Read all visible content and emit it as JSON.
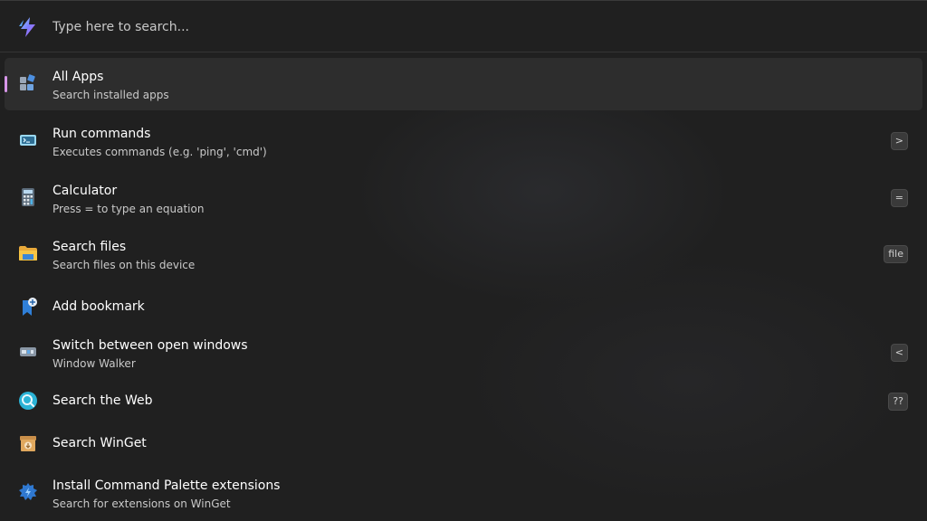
{
  "search": {
    "placeholder": "Type here to search...",
    "logo_icon": "lightning-bolt-icon"
  },
  "items": [
    {
      "title": "All Apps",
      "subtitle": "Search installed apps",
      "icon": "all-apps-icon",
      "shortcut": "",
      "selected": true
    },
    {
      "title": "Run commands",
      "subtitle": "Executes commands (e.g. 'ping', 'cmd')",
      "icon": "terminal-icon",
      "shortcut": ">"
    },
    {
      "title": "Calculator",
      "subtitle": "Press = to type an equation",
      "icon": "calculator-icon",
      "shortcut": "="
    },
    {
      "title": "Search files",
      "subtitle": "Search files on this device",
      "icon": "folder-icon",
      "shortcut": "file"
    },
    {
      "title": "Add bookmark",
      "subtitle": "",
      "icon": "bookmark-add-icon",
      "shortcut": ""
    },
    {
      "title": "Switch between open windows",
      "subtitle": "Window Walker",
      "icon": "window-switch-icon",
      "shortcut": "<"
    },
    {
      "title": "Search the Web",
      "subtitle": "",
      "icon": "web-search-icon",
      "shortcut": "??"
    },
    {
      "title": "Search WinGet",
      "subtitle": "",
      "icon": "winget-box-icon",
      "shortcut": ""
    },
    {
      "title": "Install Command Palette extensions",
      "subtitle": "Search for extensions on WinGet",
      "icon": "extensions-icon",
      "shortcut": ""
    }
  ],
  "colors": {
    "background": "#202020",
    "selected_row": "#2d2d2d",
    "selection_indicator": "#d696e8"
  }
}
